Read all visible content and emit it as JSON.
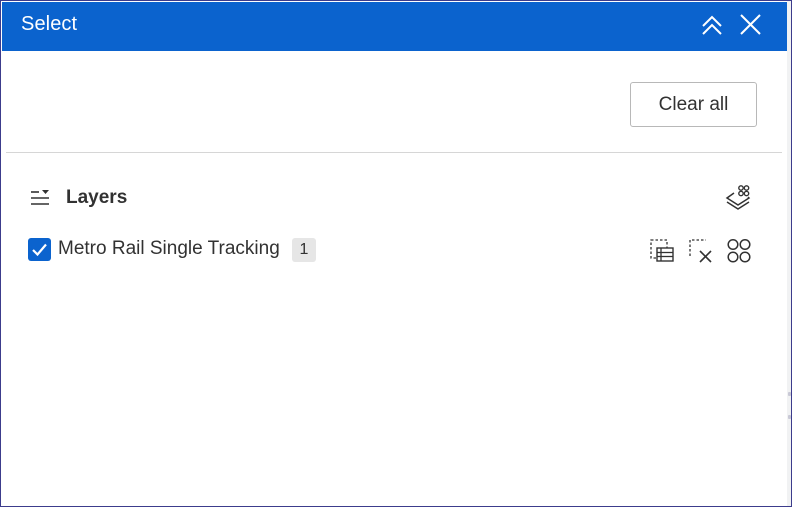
{
  "panel": {
    "title": "Select",
    "header_actions": [
      {
        "name": "collapse",
        "icon": "chevrons-up-icon"
      },
      {
        "name": "close",
        "icon": "close-icon"
      }
    ]
  },
  "toolbar": {
    "clear_all_label": "Clear all"
  },
  "layers_section": {
    "title": "Layers",
    "header_icon": "list-filter-icon",
    "action_icon": "layers-select-icon",
    "items": [
      {
        "label": "Metro Rail Single Tracking",
        "checked": true,
        "count": "1",
        "actions": [
          {
            "name": "view-table",
            "icon": "table-selection-icon"
          },
          {
            "name": "clear-selection",
            "icon": "selection-x-icon"
          },
          {
            "name": "options",
            "icon": "four-circles-icon"
          }
        ]
      }
    ]
  },
  "colors": {
    "header_bg": "#0b63ce",
    "header_text": "#ffffff",
    "text": "#323232",
    "border": "#b8b8b8",
    "checkbox": "#0b63ce",
    "badge_bg": "#e6e6e6"
  }
}
